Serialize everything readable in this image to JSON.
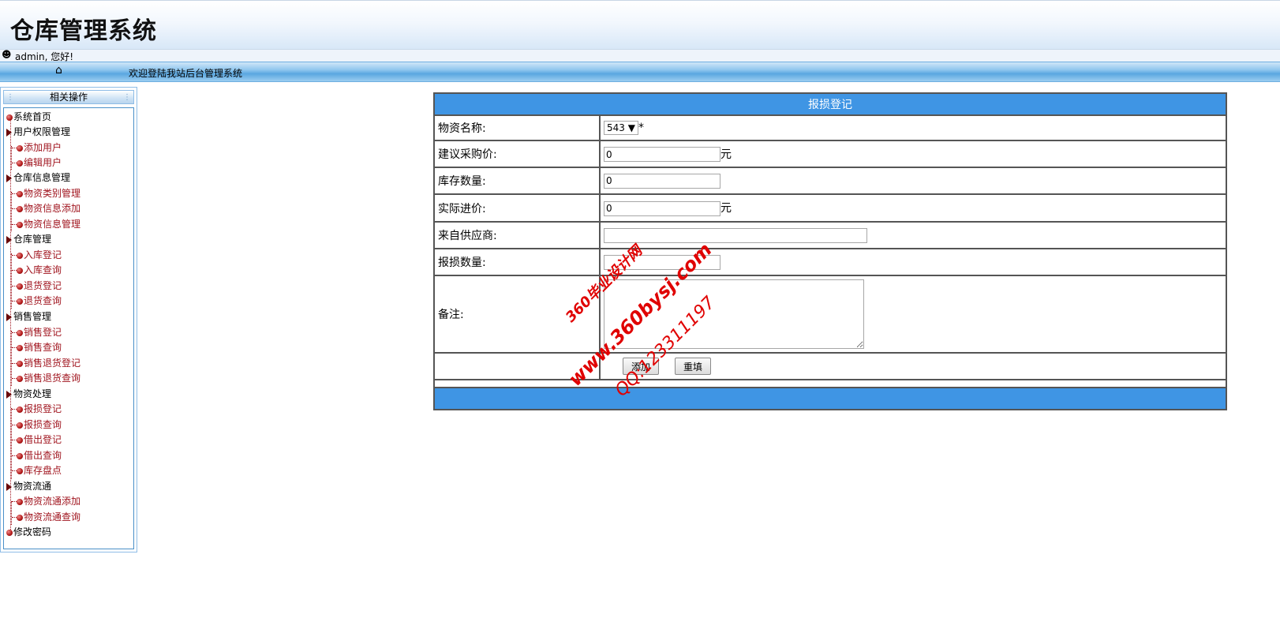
{
  "header": {
    "app_title": "仓库管理系统",
    "user_greeting": "admin, 您好!",
    "welcome_text": "欢迎登陆我站后台管理系统"
  },
  "sidebar": {
    "title": "相关操作",
    "items": [
      {
        "label": "系统首页",
        "level": 0,
        "icon": "bullet-icon"
      },
      {
        "label": "用户权限管理",
        "level": 0,
        "icon": "folder-arrow-icon"
      },
      {
        "label": "添加用户",
        "level": 1
      },
      {
        "label": "编辑用户",
        "level": 1
      },
      {
        "label": "仓库信息管理",
        "level": 0,
        "icon": "folder-arrow-icon"
      },
      {
        "label": "物资类别管理",
        "level": 1
      },
      {
        "label": "物资信息添加",
        "level": 1
      },
      {
        "label": "物资信息管理",
        "level": 1
      },
      {
        "label": "仓库管理",
        "level": 0,
        "icon": "folder-arrow-icon"
      },
      {
        "label": "入库登记",
        "level": 1
      },
      {
        "label": "入库查询",
        "level": 1
      },
      {
        "label": "退货登记",
        "level": 1
      },
      {
        "label": "退货查询",
        "level": 1
      },
      {
        "label": "销售管理",
        "level": 0,
        "icon": "folder-arrow-icon"
      },
      {
        "label": "销售登记",
        "level": 1
      },
      {
        "label": "销售查询",
        "level": 1
      },
      {
        "label": "销售退货登记",
        "level": 1
      },
      {
        "label": "销售退货查询",
        "level": 1
      },
      {
        "label": "物资处理",
        "level": 0,
        "icon": "folder-arrow-icon"
      },
      {
        "label": "报损登记",
        "level": 1
      },
      {
        "label": "报损查询",
        "level": 1
      },
      {
        "label": "借出登记",
        "level": 1
      },
      {
        "label": "借出查询",
        "level": 1
      },
      {
        "label": "库存盘点",
        "level": 1
      },
      {
        "label": "物资流通",
        "level": 0,
        "icon": "folder-arrow-icon"
      },
      {
        "label": "物资流通添加",
        "level": 1
      },
      {
        "label": "物资流通查询",
        "level": 1
      },
      {
        "label": "修改密码",
        "level": 0,
        "icon": "bullet-icon"
      }
    ]
  },
  "form": {
    "title": "报损登记",
    "material_name_label": "物资名称:",
    "material_name_value": "543",
    "required_mark": "*",
    "suggest_price_label": "建议采购价:",
    "suggest_price_value": "0",
    "stock_qty_label": "库存数量:",
    "stock_qty_value": "0",
    "actual_price_label": "实际进价:",
    "actual_price_value": "0",
    "unit_yuan": "元",
    "supplier_label": "来自供应商:",
    "supplier_value": "",
    "loss_qty_label": "报损数量:",
    "loss_qty_value": "",
    "remark_label": "备注:",
    "remark_value": "",
    "add_button": "添加",
    "reset_button": "重填"
  },
  "watermark": {
    "line1": "360毕业设计网",
    "line2": "www.360bysj.com",
    "line3": "QQ:123311197"
  },
  "colors": {
    "accent": "#3f95e4",
    "tree_link": "#a0141e",
    "watermark": "#e00000"
  }
}
